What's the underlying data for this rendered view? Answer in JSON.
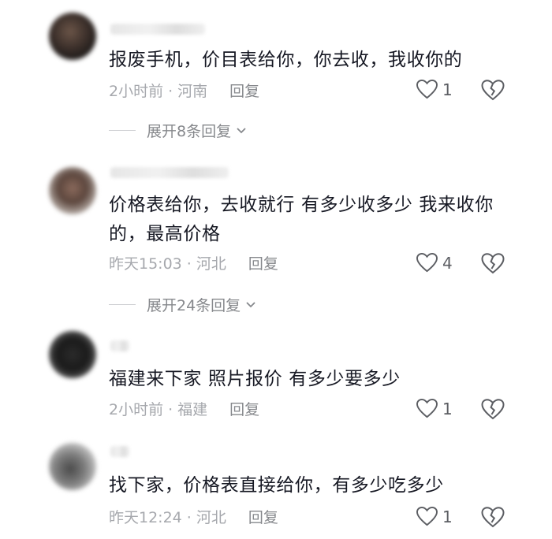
{
  "comments": [
    {
      "text": "报废手机，价目表给你，你去收，我收你的",
      "time": "2小时前",
      "location": "河南",
      "reply_label": "回复",
      "likes": "1",
      "expand_label": "展开8条回复"
    },
    {
      "text": "价格表给你，去收就行 有多少收多少 我来收你的，最高价格",
      "time": "昨天15:03",
      "location": "河北",
      "reply_label": "回复",
      "likes": "4",
      "expand_label": "展开24条回复"
    },
    {
      "text": "福建来下家 照片报价 有多少要多少",
      "time": "2小时前",
      "location": "福建",
      "reply_label": "回复",
      "likes": "1"
    },
    {
      "text": "找下家，价格表直接给你，有多少吃多少",
      "time": "昨天12:24",
      "location": "河北",
      "reply_label": "回复",
      "likes": "1"
    }
  ],
  "separator": "·",
  "icons": {
    "like": "heart-outline-icon",
    "dislike": "broken-heart-icon",
    "expand": "chevron-down-icon"
  },
  "colors": {
    "text": "#161823",
    "meta": "#a6a8ad",
    "action": "#86888c"
  }
}
